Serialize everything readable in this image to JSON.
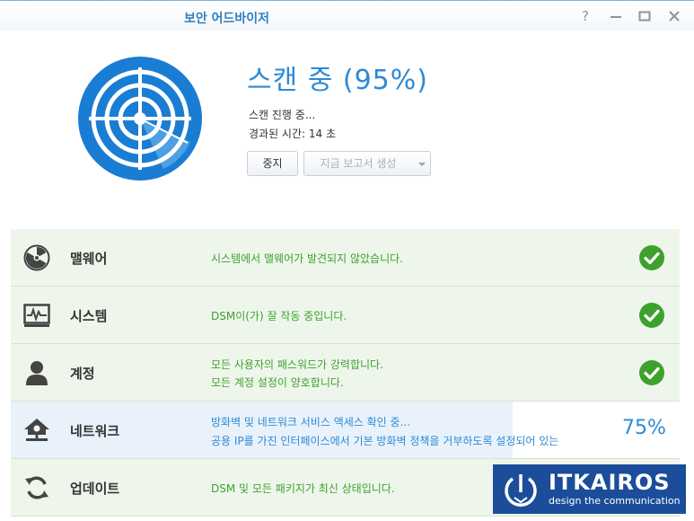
{
  "window": {
    "title": "보안 어드바이저",
    "help_label": "?"
  },
  "scan": {
    "title": "스캔 중 (95%)",
    "progress_percent": 95,
    "status": "스캔 진행 중...",
    "elapsed": "경과된 시간: 14 초"
  },
  "buttons": {
    "stop": "중지",
    "report": "지금 보고서 생성"
  },
  "categories": [
    {
      "label": "맬웨어",
      "icon": "radiation-icon",
      "messages": [
        "시스템에서 맬웨어가 발견되지 않았습니다."
      ],
      "state": "ok"
    },
    {
      "label": "시스템",
      "icon": "monitor-pulse-icon",
      "messages": [
        "DSM이(가) 잘 작동 중입니다."
      ],
      "state": "ok"
    },
    {
      "label": "계정",
      "icon": "user-icon",
      "messages": [
        "모든 사용자의 패스워드가 강력합니다.",
        "모든 계정 설정이 양호합니다."
      ],
      "state": "ok"
    },
    {
      "label": "네트워크",
      "icon": "network-home-icon",
      "messages": [
        "방화벽 및 네트워크 서비스 액세스 확인 중...",
        "공용 IP를 가진 인터페이스에서 기본 방화벽 정책을 거부하도록 설정되어 있는"
      ],
      "state": "scanning",
      "progress_label": "75%",
      "progress": 75
    },
    {
      "label": "업데이트",
      "icon": "refresh-icon",
      "messages": [
        "DSM 및 모든 패키지가 최신 상태입니다."
      ],
      "state": "ok"
    }
  ],
  "logo": {
    "title": "ITKAIROS",
    "subtitle": "design the communication"
  },
  "colors": {
    "accent": "#2d8ad6",
    "ok_green": "#3fa12d",
    "ok_row_bg": "#eef6ec",
    "logo_bg": "#1b4d9a"
  }
}
